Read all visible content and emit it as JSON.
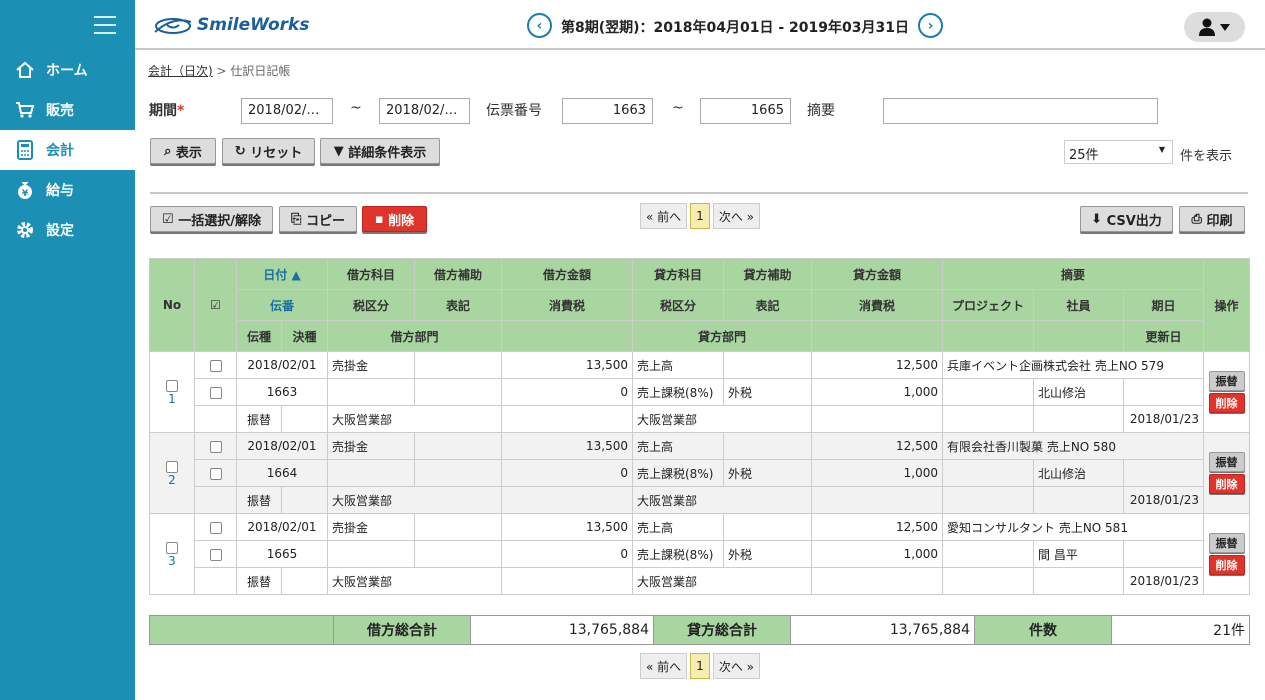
{
  "brand": {
    "name": "SmileWorks"
  },
  "period": {
    "text": "第8期(翌期)：2018年04月01日 - 2019年03月31日",
    "prev": "‹",
    "next": "›"
  },
  "nav": [
    {
      "label": "ホーム",
      "icon": "home-icon"
    },
    {
      "label": "販売",
      "icon": "cart-icon"
    },
    {
      "label": "会計",
      "icon": "calculator-icon"
    },
    {
      "label": "給与",
      "icon": "yen-bag-icon"
    },
    {
      "label": "設定",
      "icon": "gear-icon"
    }
  ],
  "breadcrumb": {
    "parent": "会計（日次)",
    "sep": " > ",
    "current": "仕訳日記帳"
  },
  "filters": {
    "period_label": "期間",
    "required": "*",
    "date_from": "2018/02/…",
    "tilde": "~",
    "date_to": "2018/02/…",
    "slip_label": "伝票番号",
    "slip_from": "1663",
    "slip_to": "1665",
    "memo_label": "摘要",
    "memo_value": ""
  },
  "buttons": {
    "show": "表示",
    "reset": "リセット",
    "detail": "詳細条件表示",
    "bulk": "一括選択/解除",
    "copy": "コピー",
    "delete": "削除",
    "csv": "CSV出力",
    "print": "印刷"
  },
  "page_size": {
    "value": "25件",
    "suffix": "件を表示"
  },
  "pager": {
    "prev": "« 前へ",
    "page": "1",
    "next": "次へ »"
  },
  "table": {
    "headers": {
      "no": "No",
      "check": "☑",
      "date": "日付 ▲",
      "debit_account": "借方科目",
      "debit_sub": "借方補助",
      "debit_amount": "借方金額",
      "credit_account": "貸方科目",
      "credit_sub": "貸方補助",
      "credit_amount": "貸方金額",
      "memo": "摘要",
      "op": "操作",
      "slip_no": "伝番",
      "debit_tax": "税区分",
      "debit_note": "表記",
      "debit_tax_amount": "消費税",
      "credit_tax": "税区分",
      "credit_note": "表記",
      "credit_tax_amount": "消費税",
      "project": "プロジェクト",
      "staff": "社員",
      "due": "期日",
      "slip_type": "伝種",
      "settle": "決種",
      "debit_dept": "借方部門",
      "credit_dept": "貸方部門",
      "updated": "更新日"
    },
    "rows": [
      {
        "no": "1",
        "date": "2018/02/01",
        "slip": "1663",
        "type": "振替",
        "d_acc": "売掛金",
        "d_amt": "13,500",
        "d_tax": "0",
        "d_dept": "大阪営業部",
        "c_acc": "売上高",
        "c_tax_acc": "売上課税(8%)",
        "c_note": "外税",
        "c_amt": "12,500",
        "c_tax": "1,000",
        "c_dept": "大阪営業部",
        "memo": "兵庫イベント企画株式会社 売上NO 579",
        "staff": "北山修治",
        "updated": "2018/01/23"
      },
      {
        "no": "2",
        "date": "2018/02/01",
        "slip": "1664",
        "type": "振替",
        "d_acc": "売掛金",
        "d_amt": "13,500",
        "d_tax": "0",
        "d_dept": "大阪営業部",
        "c_acc": "売上高",
        "c_tax_acc": "売上課税(8%)",
        "c_note": "外税",
        "c_amt": "12,500",
        "c_tax": "1,000",
        "c_dept": "大阪営業部",
        "memo": "有限会社香川製菓 売上NO 580",
        "staff": "北山修治",
        "updated": "2018/01/23"
      },
      {
        "no": "3",
        "date": "2018/02/01",
        "slip": "1665",
        "type": "振替",
        "d_acc": "売掛金",
        "d_amt": "13,500",
        "d_tax": "0",
        "d_dept": "大阪営業部",
        "c_acc": "売上高",
        "c_tax_acc": "売上課税(8%)",
        "c_note": "外税",
        "c_amt": "12,500",
        "c_tax": "1,000",
        "c_dept": "大阪営業部",
        "memo": "愛知コンサルタント 売上NO 581",
        "staff": "間 昌平",
        "updated": "2018/01/23"
      }
    ],
    "row_buttons": {
      "transfer": "振替",
      "delete": "削除"
    }
  },
  "totals": {
    "debit_label": "借方総合計",
    "debit_value": "13,765,884",
    "credit_label": "貸方総合計",
    "credit_value": "13,765,884",
    "count_label": "件数",
    "count_value": "21件"
  }
}
